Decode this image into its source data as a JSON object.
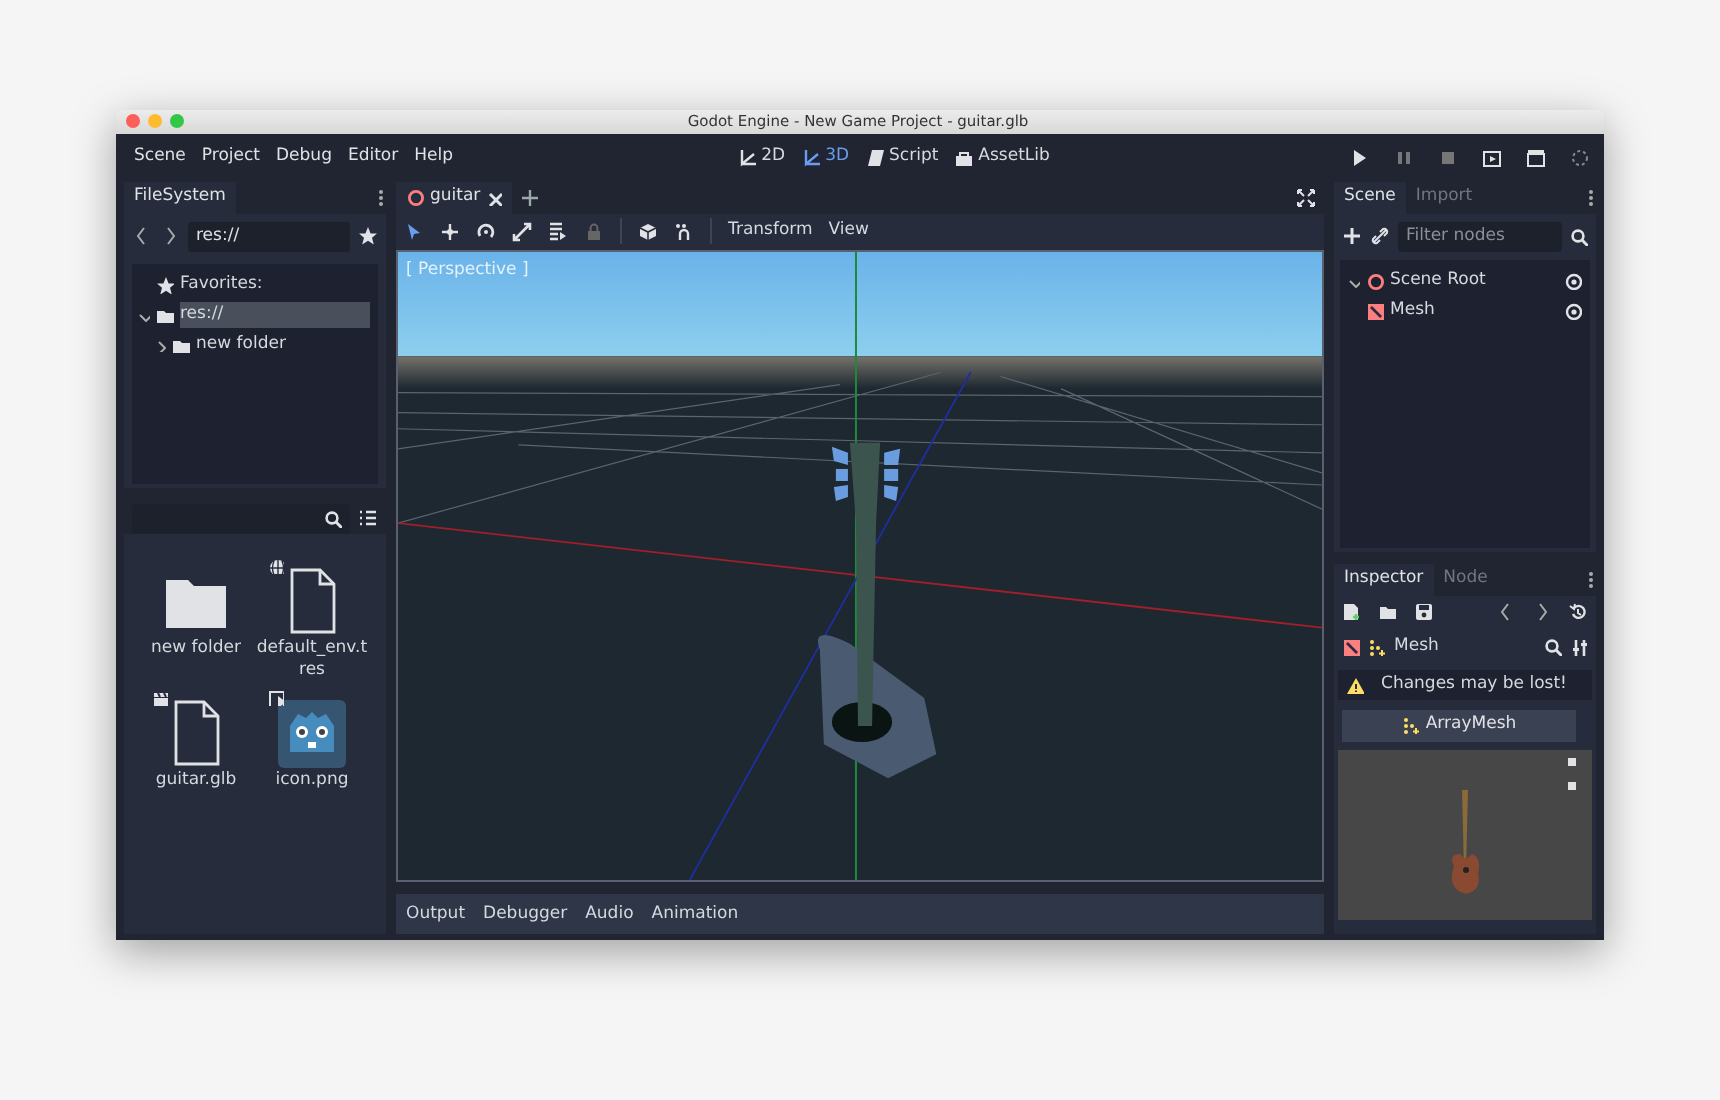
{
  "window": {
    "title": "Godot Engine - New Game Project - guitar.glb"
  },
  "menu": [
    "Scene",
    "Project",
    "Debug",
    "Editor",
    "Help"
  ],
  "workspaces": [
    {
      "label": "2D",
      "kind": "planar",
      "selected": false
    },
    {
      "label": "3D",
      "kind": "spatial",
      "selected": true
    },
    {
      "label": "Script",
      "kind": "script",
      "selected": false
    },
    {
      "label": "AssetLib",
      "kind": "assetlib",
      "selected": false
    }
  ],
  "filesystem": {
    "tabs": [
      {
        "label": "FileSystem",
        "selected": true
      }
    ],
    "path": "res://",
    "favorites_label": "Favorites:",
    "tree": [
      {
        "label": "res://",
        "selected": true,
        "expanded": true,
        "children": [
          {
            "label": "new folder",
            "selected": false,
            "expanded": false
          }
        ]
      }
    ],
    "files": [
      {
        "name": "new folder",
        "kind": "folder"
      },
      {
        "name": "default_env.tres",
        "kind": "resource"
      },
      {
        "name": "guitar.glb",
        "kind": "scene"
      },
      {
        "name": "icon.png",
        "kind": "image"
      }
    ]
  },
  "editor": {
    "tabs": [
      {
        "label": "guitar",
        "selected": true
      }
    ],
    "toolbar_menus": [
      "Transform",
      "View"
    ],
    "viewport_label": "[ Perspective ]",
    "bottom_tabs": [
      "Output",
      "Debugger",
      "Audio",
      "Animation"
    ]
  },
  "scene": {
    "tabs": [
      {
        "label": "Scene",
        "selected": true
      },
      {
        "label": "Import",
        "selected": false
      }
    ],
    "filter": {
      "placeholder": "Filter nodes"
    },
    "tree": [
      {
        "label": "Scene Root",
        "kind": "spatial",
        "expanded": true,
        "children": [
          {
            "label": "Mesh",
            "kind": "mesh"
          }
        ]
      }
    ]
  },
  "inspector": {
    "tabs": [
      {
        "label": "Inspector",
        "selected": true
      },
      {
        "label": "Node",
        "selected": false
      }
    ],
    "object": "Mesh",
    "warning": "Changes may be lost!",
    "resource": "ArrayMesh"
  }
}
